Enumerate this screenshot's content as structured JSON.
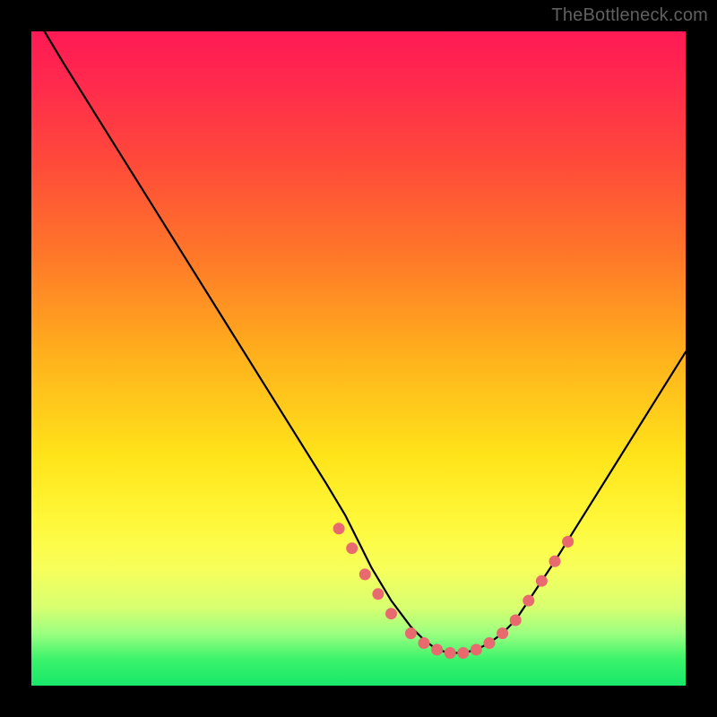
{
  "watermark": "TheBottleneck.com",
  "chart_data": {
    "type": "line",
    "title": "",
    "xlabel": "",
    "ylabel": "",
    "xlim": [
      0,
      100
    ],
    "ylim": [
      0,
      100
    ],
    "grid": false,
    "series": [
      {
        "name": "curve",
        "x": [
          2,
          5,
          10,
          15,
          20,
          25,
          30,
          35,
          40,
          45,
          48,
          50,
          52,
          55,
          58,
          60,
          62,
          64,
          66,
          68,
          70,
          72,
          74,
          76,
          80,
          85,
          90,
          95,
          100
        ],
        "y": [
          100,
          95,
          87,
          79,
          71,
          63,
          55,
          47,
          39,
          31,
          26,
          22,
          18,
          13,
          9,
          7,
          5.5,
          5,
          5,
          5.5,
          6.5,
          8,
          10,
          13,
          19,
          27,
          35,
          43,
          51
        ],
        "color": "#000000",
        "linewidth": 2.2
      }
    ],
    "markers": [
      {
        "x": 47,
        "y": 24,
        "r": 6.5,
        "color": "#e86a6f"
      },
      {
        "x": 49,
        "y": 21,
        "r": 6.5,
        "color": "#e86a6f"
      },
      {
        "x": 51,
        "y": 17,
        "r": 6.5,
        "color": "#e86a6f"
      },
      {
        "x": 53,
        "y": 14,
        "r": 6.5,
        "color": "#e86a6f"
      },
      {
        "x": 55,
        "y": 11,
        "r": 6.5,
        "color": "#e86a6f"
      },
      {
        "x": 58,
        "y": 8,
        "r": 6.5,
        "color": "#e86a6f"
      },
      {
        "x": 60,
        "y": 6.5,
        "r": 6.5,
        "color": "#e86a6f"
      },
      {
        "x": 62,
        "y": 5.5,
        "r": 6.5,
        "color": "#e86a6f"
      },
      {
        "x": 64,
        "y": 5,
        "r": 6.5,
        "color": "#e86a6f"
      },
      {
        "x": 66,
        "y": 5,
        "r": 6.5,
        "color": "#e86a6f"
      },
      {
        "x": 68,
        "y": 5.5,
        "r": 6.5,
        "color": "#e86a6f"
      },
      {
        "x": 70,
        "y": 6.5,
        "r": 6.5,
        "color": "#e86a6f"
      },
      {
        "x": 72,
        "y": 8,
        "r": 6.5,
        "color": "#e86a6f"
      },
      {
        "x": 74,
        "y": 10,
        "r": 6.5,
        "color": "#e86a6f"
      },
      {
        "x": 76,
        "y": 13,
        "r": 6.5,
        "color": "#e86a6f"
      },
      {
        "x": 78,
        "y": 16,
        "r": 6.5,
        "color": "#e86a6f"
      },
      {
        "x": 80,
        "y": 19,
        "r": 6.5,
        "color": "#e86a6f"
      },
      {
        "x": 82,
        "y": 22,
        "r": 6.5,
        "color": "#e86a6f"
      }
    ]
  }
}
